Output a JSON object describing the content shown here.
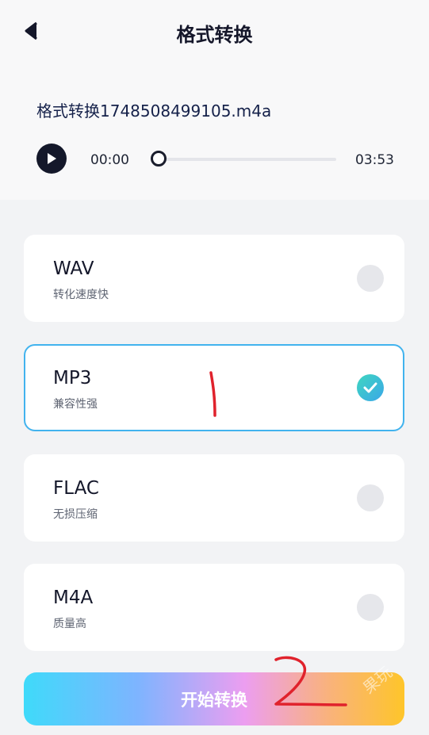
{
  "header": {
    "title": "格式转换",
    "back_icon": "chevron-left-icon"
  },
  "player": {
    "file_name": "格式转换1748508499105.m4a",
    "current_time": "00:00",
    "duration": "03:53",
    "progress": 0,
    "play_icon": "play-icon"
  },
  "options": [
    {
      "name": "WAV",
      "desc": "转化速度快",
      "selected": false
    },
    {
      "name": "MP3",
      "desc": "兼容性强",
      "selected": true
    },
    {
      "name": "FLAC",
      "desc": "无损压缩",
      "selected": false
    },
    {
      "name": "M4A",
      "desc": "质量高",
      "selected": false
    }
  ],
  "start_button": {
    "label": "开始转换"
  },
  "watermark": "果玩",
  "annotations": {
    "mark_1": "1",
    "mark_2": "2",
    "color": "#e0222c"
  },
  "colors": {
    "selected_border": "#42b3ee",
    "check_gradient": [
      "#3fd6c0",
      "#3aa7e8"
    ],
    "button_gradient": [
      "#3fdafa",
      "#7eb4ff",
      "#ec9ef0",
      "#f9b27c",
      "#fec52a"
    ]
  }
}
